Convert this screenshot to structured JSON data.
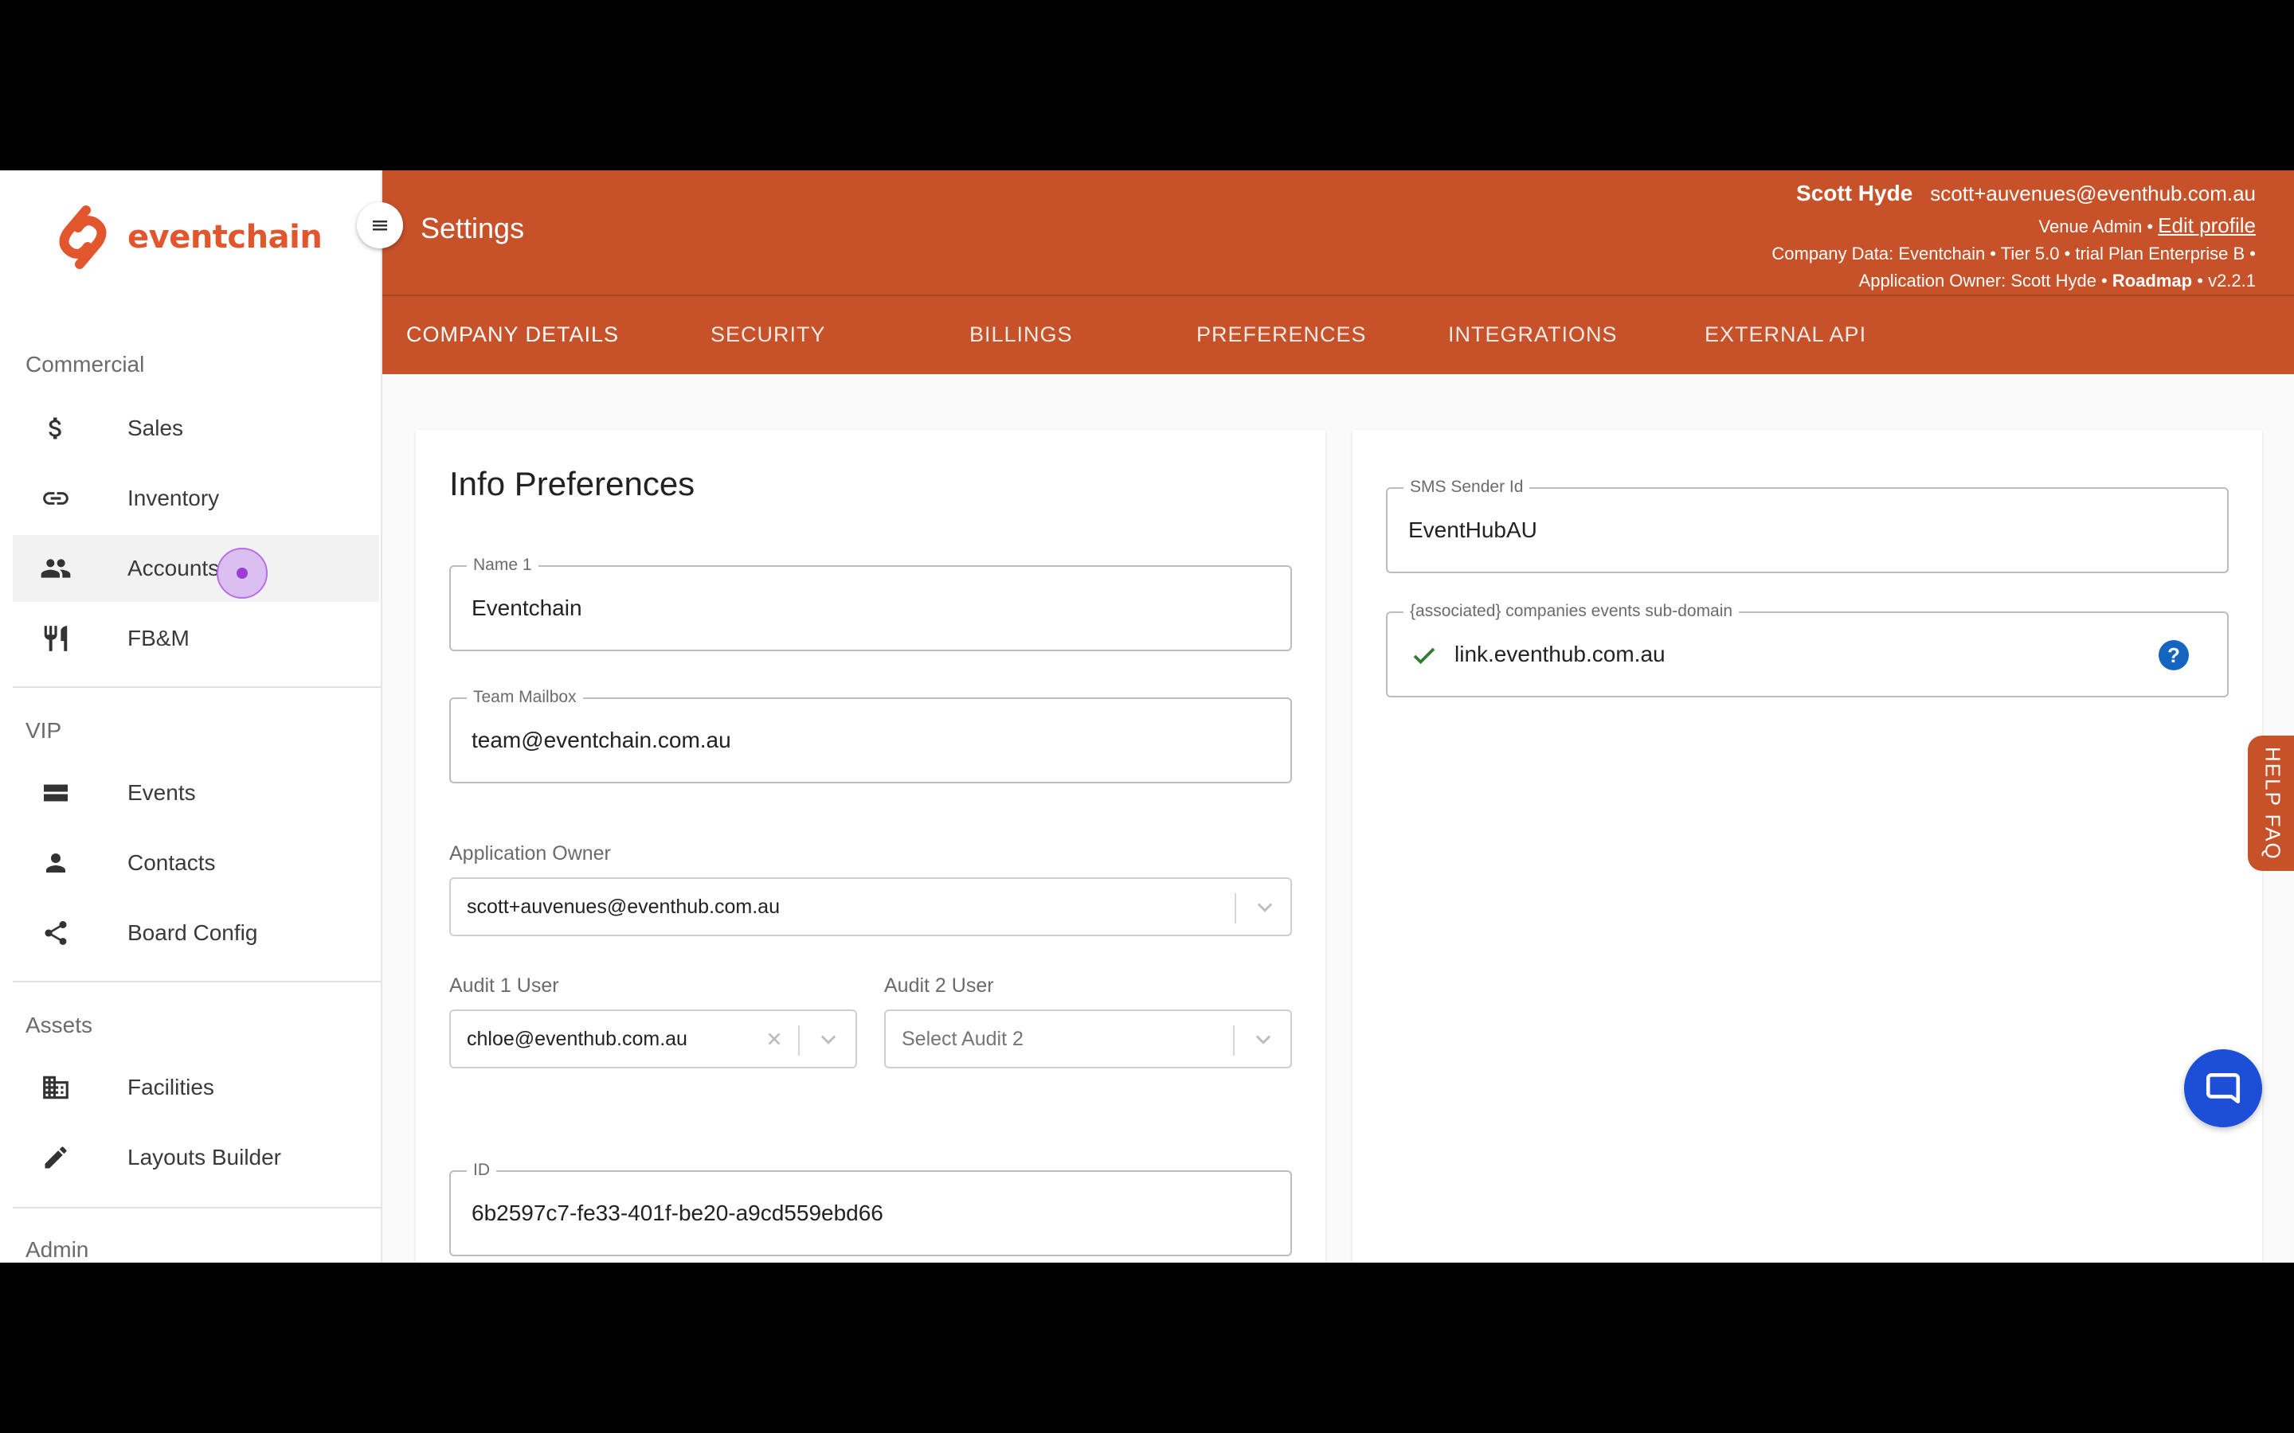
{
  "brand": {
    "name": "eventchain",
    "color": "#e2562e"
  },
  "header": {
    "title": "Settings",
    "user_name": "Scott Hyde",
    "user_email": "scott+auvenues@eventhub.com.au",
    "role": "Venue Admin •",
    "edit_profile": "Edit profile",
    "company_line": "Company Data: Eventchain • Tier 5.0 • trial Plan Enterprise B •",
    "owner_prefix": "Application Owner: Scott Hyde •",
    "roadmap": "Roadmap",
    "version": "• v2.2.1",
    "color": "#c7522a"
  },
  "tabs": [
    {
      "label": "COMPANY DETAILS",
      "active": true
    },
    {
      "label": "SECURITY"
    },
    {
      "label": "BILLINGS"
    },
    {
      "label": "PREFERENCES"
    },
    {
      "label": "INTEGRATIONS"
    },
    {
      "label": "EXTERNAL API"
    }
  ],
  "sidebar": {
    "sections": [
      {
        "title": "Commercial",
        "items": [
          {
            "label": "Sales",
            "icon": "dollar-icon"
          },
          {
            "label": "Inventory",
            "icon": "link-icon"
          },
          {
            "label": "Accounts",
            "icon": "people-icon",
            "active": true
          },
          {
            "label": "FB&M",
            "icon": "restaurant-icon"
          }
        ]
      },
      {
        "title": "VIP",
        "items": [
          {
            "label": "Events",
            "icon": "events-icon"
          },
          {
            "label": "Contacts",
            "icon": "person-icon"
          },
          {
            "label": "Board Config",
            "icon": "share-icon"
          }
        ]
      },
      {
        "title": "Assets",
        "items": [
          {
            "label": "Facilities",
            "icon": "building-icon"
          },
          {
            "label": "Layouts Builder",
            "icon": "pencil-icon"
          }
        ]
      },
      {
        "title": "Admin",
        "items": []
      }
    ]
  },
  "info_preferences": {
    "title": "Info Preferences",
    "name1": {
      "label": "Name 1",
      "value": "Eventchain"
    },
    "team_mailbox": {
      "label": "Team Mailbox",
      "value": "team@eventchain.com.au"
    },
    "application_owner": {
      "label": "Application Owner",
      "value": "scott+auvenues@eventhub.com.au"
    },
    "audit1": {
      "label": "Audit 1 User",
      "value": "chloe@eventhub.com.au"
    },
    "audit2": {
      "label": "Audit 2 User",
      "placeholder": "Select Audit 2"
    },
    "id": {
      "label": "ID",
      "value": "6b2597c7-fe33-401f-be20-a9cd559ebd66"
    }
  },
  "sms": {
    "sender_label": "SMS Sender Id",
    "sender_value": "EventHubAU",
    "subdomain_label": "{associated} companies events sub-domain",
    "subdomain_value": "link.eventhub.com.au"
  },
  "help_faq": "HELP FAQ"
}
